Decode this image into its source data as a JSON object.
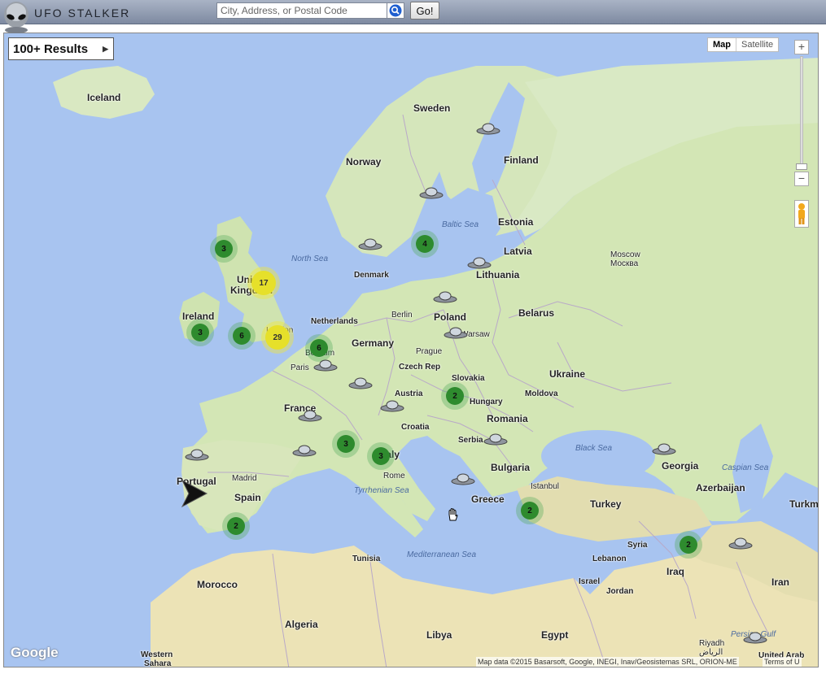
{
  "header": {
    "logo_text": "UFO STALKER",
    "search_placeholder": "City, Address, or Postal Code",
    "go_label": "Go!"
  },
  "map": {
    "results_label": "100+ Results",
    "maptype": {
      "map": "Map",
      "satellite": "Satellite"
    },
    "google_logo": "Google",
    "attribution": "Map data ©2015 Basarsoft, Google, INEGI, Inav/Geosistemas SRL, ORION-ME",
    "terms": "Terms of U",
    "places": {
      "iceland": "Iceland",
      "sweden": "Sweden",
      "norway": "Norway",
      "finland": "Finland",
      "estonia": "Estonia",
      "latvia": "Latvia",
      "lithuania": "Lithuania",
      "denmark": "Denmark",
      "united_kingdom_1": "United",
      "united_kingdom_2": "Kingdom",
      "ireland": "Ireland",
      "netherlands": "Netherlands",
      "berlin": "Berlin",
      "poland": "Poland",
      "warsaw": "Warsaw",
      "belarus": "Belarus",
      "moscow": "Moscow",
      "moscow_ru": "Москва",
      "germany": "Germany",
      "london": "London",
      "belgium": "Belgium",
      "paris": "Paris",
      "prague": "Prague",
      "czech_rep": "Czech Rep",
      "ukraine": "Ukraine",
      "slovakia": "Slovakia",
      "austria": "Austria",
      "hungary": "Hungary",
      "moldova": "Moldova",
      "france": "France",
      "croatia": "Croatia",
      "romania": "Romania",
      "serbia": "Serbia",
      "italy": "Italy",
      "rome": "Rome",
      "bulgaria": "Bulgaria",
      "georgia": "Georgia",
      "portugal": "Portugal",
      "madrid": "Madrid",
      "spain": "Spain",
      "istanbul": "Istanbul",
      "greece": "Greece",
      "turkey": "Turkey",
      "azerbaijan": "Azerbaijan",
      "turkm": "Turkm",
      "syria": "Syria",
      "lebanon": "Lebanon",
      "tunisia": "Tunisia",
      "israel": "Israel",
      "jordan": "Jordan",
      "iraq": "Iraq",
      "iran": "Iran",
      "morocco": "Morocco",
      "algeria": "Algeria",
      "libya": "Libya",
      "egypt": "Egypt",
      "western_sahara_1": "Western",
      "western_sahara_2": "Sahara",
      "riyadh": "Riyadh",
      "riyadh_ar": "الرياض",
      "uae": "United Arab",
      "persian_gulf": "Persian Gulf"
    },
    "seas": {
      "north_sea": "North Sea",
      "baltic_sea": "Baltic Sea",
      "black_sea": "Black Sea",
      "caspian_sea": "Caspian Sea",
      "tyrrhenian_sea": "Tyrrhenian Sea",
      "mediterranean_sea": "Mediterranean Sea"
    },
    "clusters": {
      "scotland": "3",
      "uk": "17",
      "ireland": "3",
      "wales": "6",
      "london": "29",
      "belgium": "6",
      "sweden": "4",
      "hungary": "2",
      "france_south": "3",
      "italy": "3",
      "spain": "2",
      "turkey": "2",
      "iraq": "2"
    }
  }
}
